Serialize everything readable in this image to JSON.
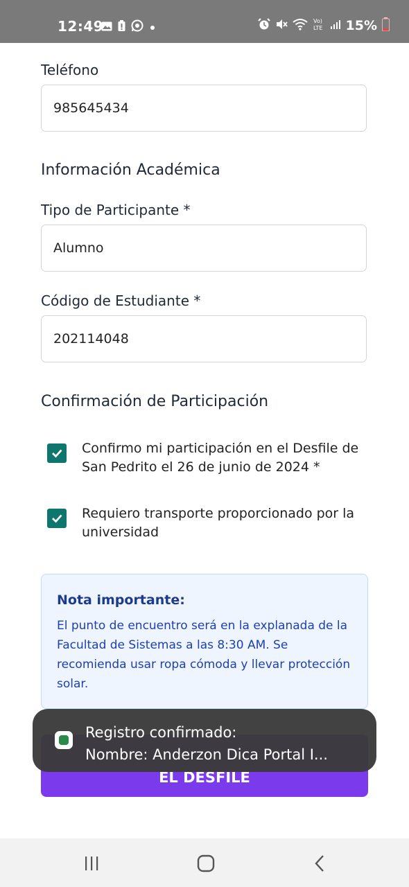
{
  "status_bar": {
    "time": "12:49",
    "battery": "15%",
    "icons_left": [
      "image-icon",
      "battery-saver-icon",
      "whatsapp-icon",
      "dot-icon"
    ],
    "icons_right": [
      "alarm-icon",
      "mute-icon",
      "wifi-icon",
      "volte-icon",
      "signal-icon",
      "battery-icon"
    ]
  },
  "form": {
    "telefono": {
      "label": "Teléfono",
      "value": "985645434"
    },
    "section_academica": "Información Académica",
    "tipo_participante": {
      "label": "Tipo de Participante *",
      "value": "Alumno"
    },
    "codigo_estudiante": {
      "label": "Código de Estudiante *",
      "value": "202114048"
    },
    "section_confirmacion": "Confirmación de Participación",
    "checks": [
      {
        "label": "Confirmo mi participación en el Desfile de San Pedrito el 26 de junio de 2024 *",
        "checked": true
      },
      {
        "label": "Requiero transporte proporcionado por la universidad",
        "checked": true
      }
    ],
    "note": {
      "title": "Nota importante:",
      "body": "El punto de encuentro será en la explanada de la Facultad de Sistemas a las 8:30 AM. Se recomienda usar ropa cómoda y llevar protección solar."
    },
    "submit_label": "EL DESFILE"
  },
  "toast": {
    "line1": "Registro confirmado:",
    "line2": "Nombre: Anderzon Dica Portal I..."
  },
  "colors": {
    "status_bar": "#7a7a7a",
    "checkbox": "#0f766e",
    "note_bg": "#eef5ff",
    "note_text": "#1e40af",
    "submit": "#7c3aed"
  }
}
